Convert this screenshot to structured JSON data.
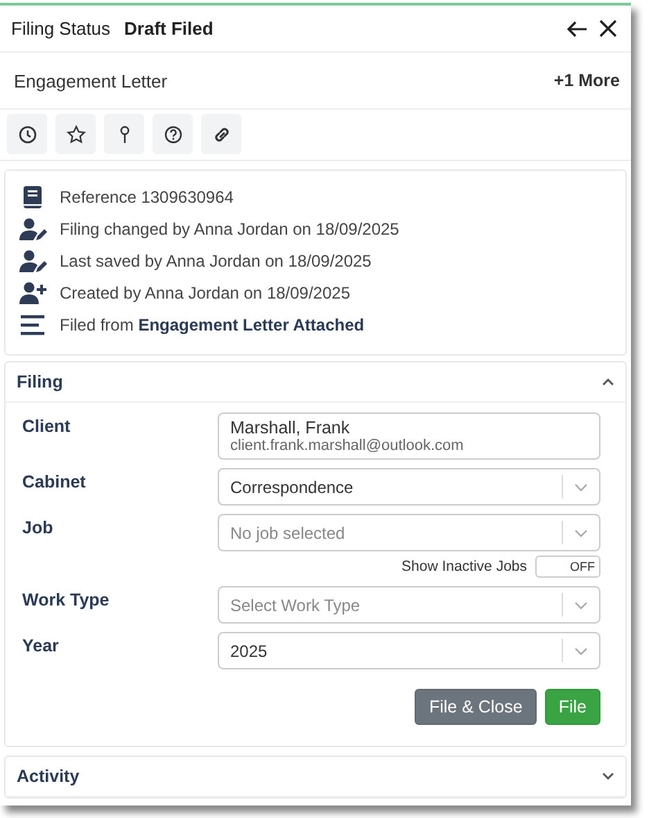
{
  "header": {
    "label": "Filing Status",
    "status": "Draft Filed"
  },
  "document": {
    "title": "Engagement Letter",
    "more": "+1 More"
  },
  "info": [
    {
      "kind": "reference",
      "text": "Reference 1309630964"
    },
    {
      "kind": "edited",
      "text": "Filing changed by Anna Jordan on 18/09/2025"
    },
    {
      "kind": "edited",
      "text": "Last saved by Anna Jordan on 18/09/2025"
    },
    {
      "kind": "created",
      "text": "Created by Anna Jordan on 18/09/2025"
    },
    {
      "kind": "source",
      "text": "Filed from **Engagement Letter Attached**"
    }
  ],
  "filing": {
    "title": "Filing",
    "expanded": true,
    "fields": [
      {
        "kind": "contact",
        "label": "Client",
        "value": "Marshall, Frank",
        "detail": "client.frank.marshall@outlook.com"
      },
      {
        "kind": "select",
        "label": "Cabinet",
        "value": "Correspondence"
      },
      {
        "kind": "select",
        "label": "Job",
        "placeholder": "No job selected",
        "toggle": {
          "label": "Show Inactive Jobs",
          "on": false,
          "text": "OFF"
        }
      },
      {
        "kind": "select",
        "label": "Work Type",
        "placeholder": "Select Work Type"
      },
      {
        "kind": "select",
        "label": "Year",
        "value": "2025"
      }
    ],
    "buttons": [
      {
        "label": "File & Close",
        "kind": "secondary"
      },
      {
        "label": "File",
        "kind": "primary"
      }
    ]
  },
  "activity": {
    "title": "Activity",
    "expanded": false
  }
}
